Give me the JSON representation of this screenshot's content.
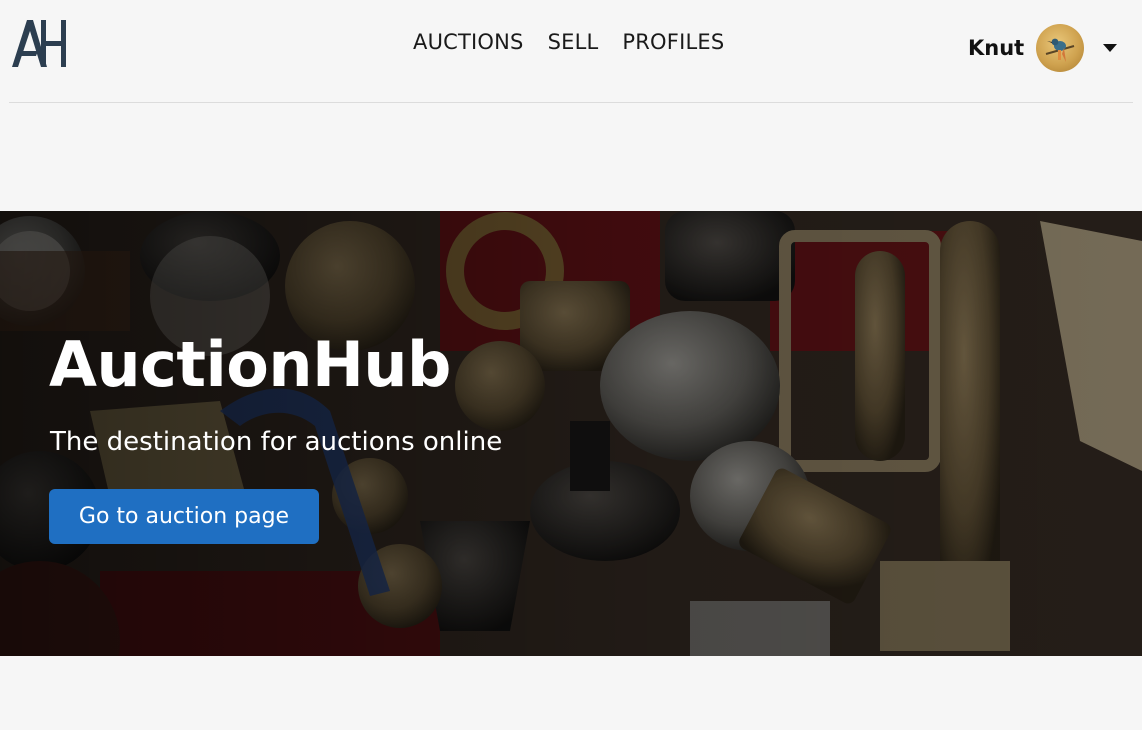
{
  "header": {
    "logo_text": "AH",
    "nav": [
      {
        "label": "AUCTIONS"
      },
      {
        "label": "SELL"
      },
      {
        "label": "PROFILES"
      }
    ],
    "user": {
      "name": "Knut"
    }
  },
  "hero": {
    "title": "AuctionHub",
    "subtitle": "The destination for auctions online",
    "button_label": "Go to auction page"
  },
  "colors": {
    "page_background": "#f6f6f6",
    "button_primary": "#1f6fc2",
    "logo": "#2c3e50"
  },
  "icons": {
    "logo": "ah-logo-icon",
    "avatar": "user-avatar",
    "dropdown": "caret-down-icon"
  }
}
